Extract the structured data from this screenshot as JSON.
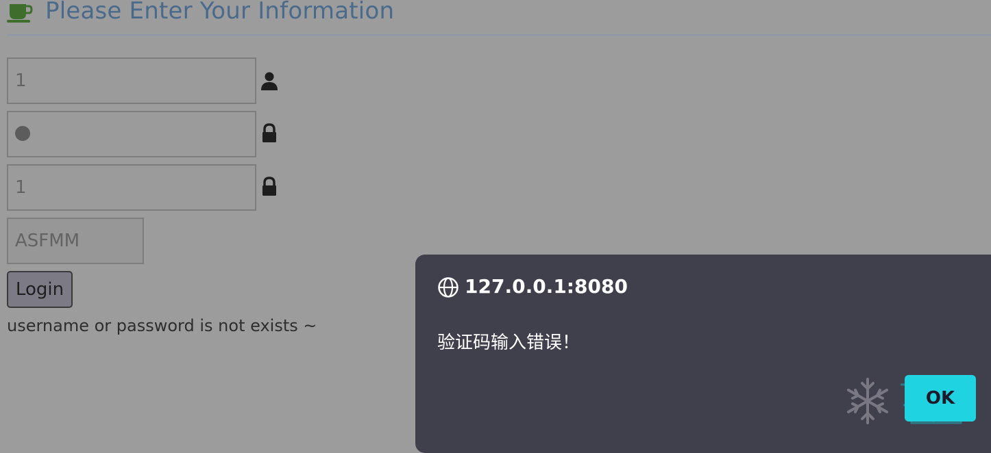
{
  "header": {
    "title": "Please Enter Your Information",
    "icon": "coffee-cup-icon",
    "accent_color": "#4a6a8c",
    "icon_color": "#3f6e2c"
  },
  "form": {
    "username_value": "1",
    "password_masked": true,
    "confirm_password_value": "1",
    "captcha_value": "ASFMM",
    "login_label": "Login",
    "username_icon": "user-icon",
    "password_icon": "lock-icon",
    "confirm_icon": "lock-icon"
  },
  "status": {
    "message": "username or password is not exists ~"
  },
  "alert": {
    "origin": "127.0.0.1:8080",
    "message": "验证码输入错误！",
    "ok_label": "OK",
    "origin_icon": "globe-icon",
    "watermark_icon": "snowflake-watermark-icon",
    "background": "#403f4c",
    "button_color": "#1fd3e0"
  }
}
